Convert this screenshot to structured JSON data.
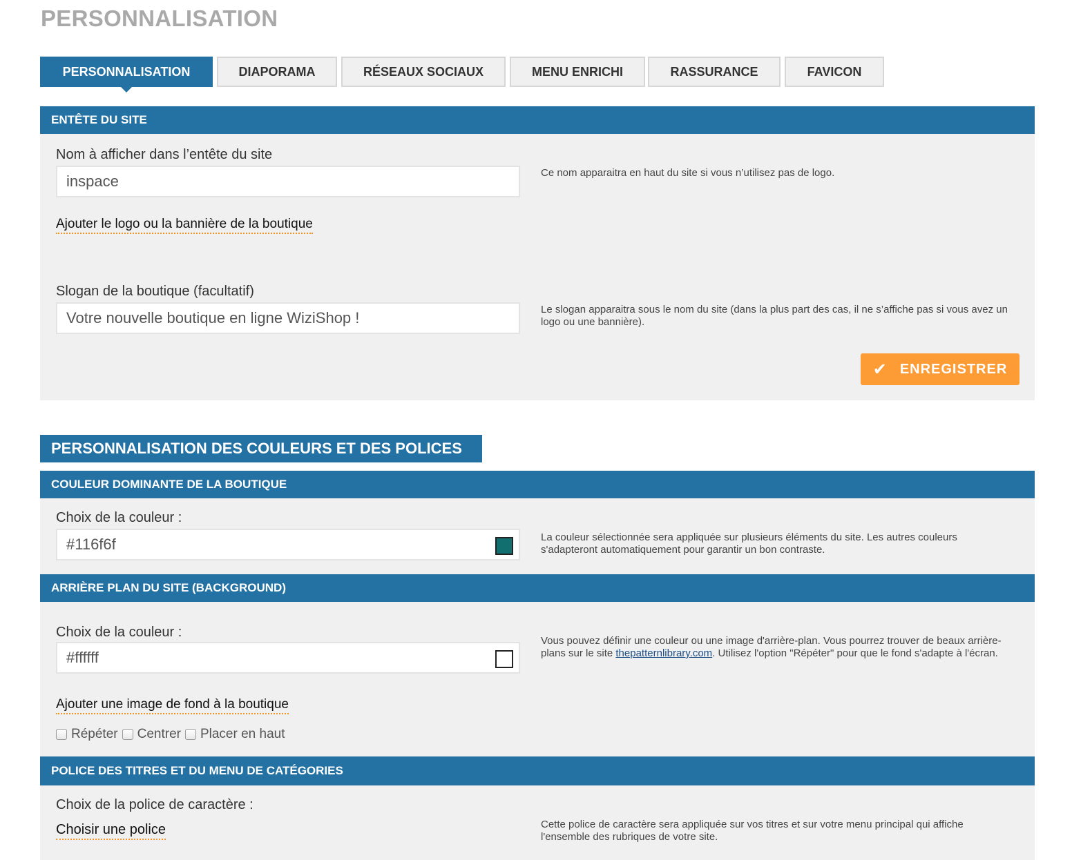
{
  "page_title": "PERSONNALISATION",
  "tabs": [
    {
      "label": "PERSONNALISATION",
      "active": true
    },
    {
      "label": "DIAPORAMA"
    },
    {
      "label": "RÉSEAUX SOCIAUX"
    },
    {
      "label": "MENU ENRICHI"
    },
    {
      "label": "RASSURANCE"
    },
    {
      "label": "FAVICON"
    }
  ],
  "header_section": {
    "title": "ENTÊTE DU SITE",
    "site_name_label": "Nom à afficher dans l’entête du site",
    "site_name_value": "inspace",
    "site_name_help": "Ce nom apparaitra en haut du site si vous n’utilisez pas de logo.",
    "logo_link": "Ajouter le logo ou la bannière de la boutique",
    "slogan_label": "Slogan de la boutique (facultatif)",
    "slogan_value": "Votre nouvelle boutique en ligne WiziShop !",
    "slogan_help": "Le slogan apparaitra sous le nom du site (dans la plus part des cas, il ne s’affiche pas si vous avez un logo ou une bannière).",
    "save_label": "ENREGISTRER"
  },
  "colors_section": {
    "title": "PERSONNALISATION DES COULEURS ET DES POLICES",
    "dominant": {
      "title": "COULEUR DOMINANTE DE LA BOUTIQUE",
      "label": "Choix de la couleur :",
      "value": "#116f6f",
      "swatch_color": "#116f6f",
      "help": "La couleur sélectionnée sera appliquée sur plusieurs éléments du site. Les autres couleurs s'adapteront automatiquement pour garantir un bon contraste."
    },
    "background": {
      "title": "ARRIÈRE PLAN DU SITE (BACKGROUND)",
      "label": "Choix de la couleur :",
      "value": "#ffffff",
      "swatch_color": "#ffffff",
      "help_before": "Vous pouvez définir une couleur ou une image d'arrière-plan. Vous pourrez trouver de beaux arrière-plans sur le site ",
      "help_link": "thepatternlibrary.com",
      "help_after": ". Utilisez l'option \"Répéter\" pour que le fond s'adapte à l'écran.",
      "image_link": "Ajouter une image de fond à la boutique",
      "options": [
        "Répéter",
        "Centrer",
        "Placer en haut"
      ]
    },
    "font": {
      "title": "POLICE DES TITRES ET DU MENU DE CATÉGORIES",
      "label": "Choix de la police de caractère :",
      "choose_link": "Choisir une police",
      "help": "Cette police de caractère sera appliquée sur vos titres et sur votre menu principal qui affiche l'ensemble des rubriques de votre site."
    }
  }
}
